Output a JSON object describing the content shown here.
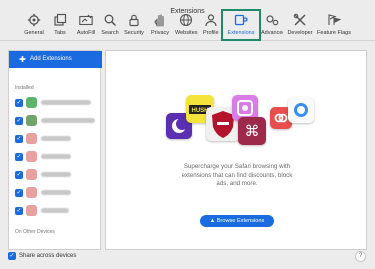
{
  "window": {
    "title": "Extensions"
  },
  "toolbar": {
    "items": [
      {
        "label": "General",
        "icon": "gear-icon"
      },
      {
        "label": "Tabs",
        "icon": "tabs-icon"
      },
      {
        "label": "AutoFill",
        "icon": "autofill-icon"
      },
      {
        "label": "Search",
        "icon": "search-icon"
      },
      {
        "label": "Security",
        "icon": "lock-icon"
      },
      {
        "label": "Privacy",
        "icon": "hand-icon"
      },
      {
        "label": "Websites",
        "icon": "globe-icon"
      },
      {
        "label": "Profiles",
        "icon": "person-icon"
      },
      {
        "label": "Extensions",
        "icon": "puzzle-icon",
        "active": true
      },
      {
        "label": "Advanced",
        "icon": "gears-icon"
      },
      {
        "label": "Developer",
        "icon": "wrench-icon"
      },
      {
        "label": "Feature Flags",
        "icon": "flags-icon"
      }
    ]
  },
  "sidebar": {
    "add_label": "Add Extensions",
    "installed_label": "Installed",
    "other_label": "On Other Devices",
    "extensions": [
      {
        "enabled": true,
        "color": "#5bb36e"
      },
      {
        "enabled": true,
        "color": "#6fa36a"
      },
      {
        "enabled": true,
        "color": "#e07a7a"
      },
      {
        "enabled": true,
        "color": "#e07a7a"
      },
      {
        "enabled": true,
        "color": "#e07a7a"
      },
      {
        "enabled": true,
        "color": "#e07a7a"
      },
      {
        "enabled": true,
        "color": "#e07a7a"
      }
    ]
  },
  "content": {
    "promo_line1": "Supercharge your Safari browsing with",
    "promo_line2": "extensions that can find discounts, block",
    "promo_line3": "ads, and more.",
    "browse_label": "Browse Extensions",
    "hush_label": "HUSH"
  },
  "footer": {
    "share_label": "Share across devices",
    "share_checked": true,
    "help_label": "?"
  },
  "colors": {
    "accent": "#1b6be0",
    "highlight": "#1f8a6b"
  }
}
